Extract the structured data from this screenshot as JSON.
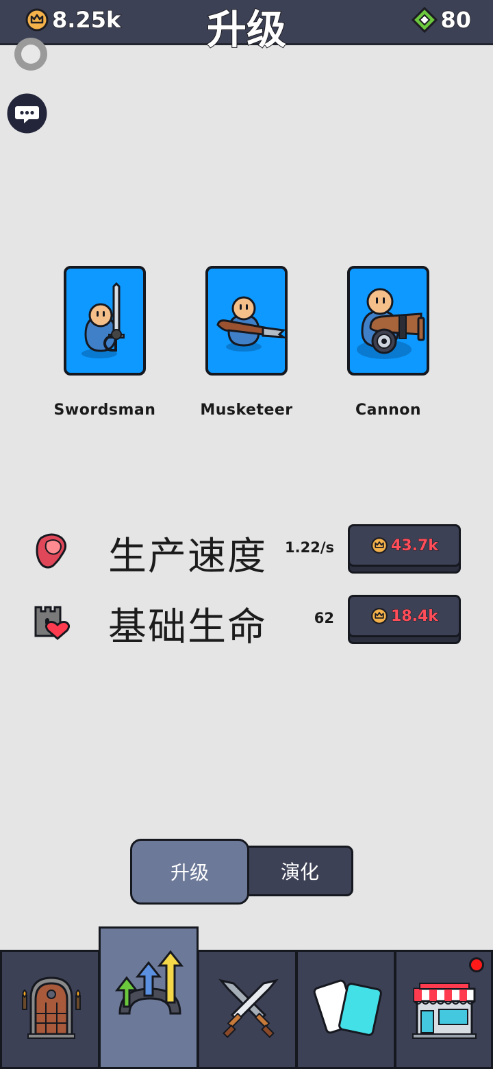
{
  "header": {
    "title": "升级",
    "coins": "8.25k",
    "gems": "80"
  },
  "units": [
    {
      "name": "Swordsman",
      "icon": "swordsman-icon"
    },
    {
      "name": "Musketeer",
      "icon": "musketeer-icon"
    },
    {
      "name": "Cannon",
      "icon": "cannon-icon"
    }
  ],
  "stats": [
    {
      "label": "生产速度",
      "value": "1.22/s",
      "price": "43.7k",
      "icon": "meat-icon"
    },
    {
      "label": "基础生命",
      "value": "62",
      "price": "18.4k",
      "icon": "castle-heart-icon"
    }
  ],
  "toggle": {
    "left": "升级",
    "right": "演化",
    "active": "left"
  },
  "nav": {
    "items": [
      "door-icon",
      "upgrade-arrows-icon",
      "crossed-swords-icon",
      "cards-icon",
      "shop-icon"
    ],
    "active_index": 1,
    "shop_badge": true
  },
  "colors": {
    "panel": "#3d4155",
    "active": "#6c7998",
    "card": "#0d99ff",
    "price": "#ff4d5a",
    "gem": "#6cc83c",
    "coin": "#f5b14a"
  }
}
